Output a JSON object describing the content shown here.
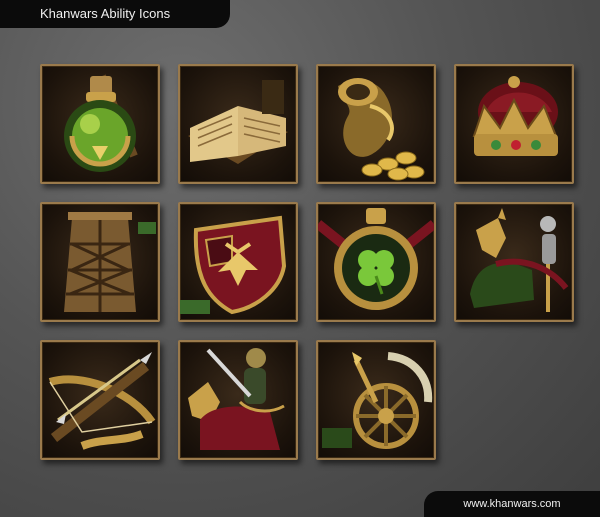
{
  "header": {
    "title": "Khanwars Ability Icons"
  },
  "footer": {
    "url": "www.khanwars.com"
  },
  "icons": [
    {
      "name": "potion-icon"
    },
    {
      "name": "book-icon"
    },
    {
      "name": "gold-coins-icon"
    },
    {
      "name": "crown-icon"
    },
    {
      "name": "siege-tower-icon"
    },
    {
      "name": "eagle-shield-icon"
    },
    {
      "name": "clover-amulet-icon"
    },
    {
      "name": "horse-knight-icon"
    },
    {
      "name": "crossbow-icon"
    },
    {
      "name": "mounted-knight-icon"
    },
    {
      "name": "war-chariot-icon"
    }
  ],
  "colors": {
    "frame": "#9a7a4c",
    "gold": "#c9a14a",
    "green": "#6aa52a",
    "crimson": "#7a1420"
  }
}
